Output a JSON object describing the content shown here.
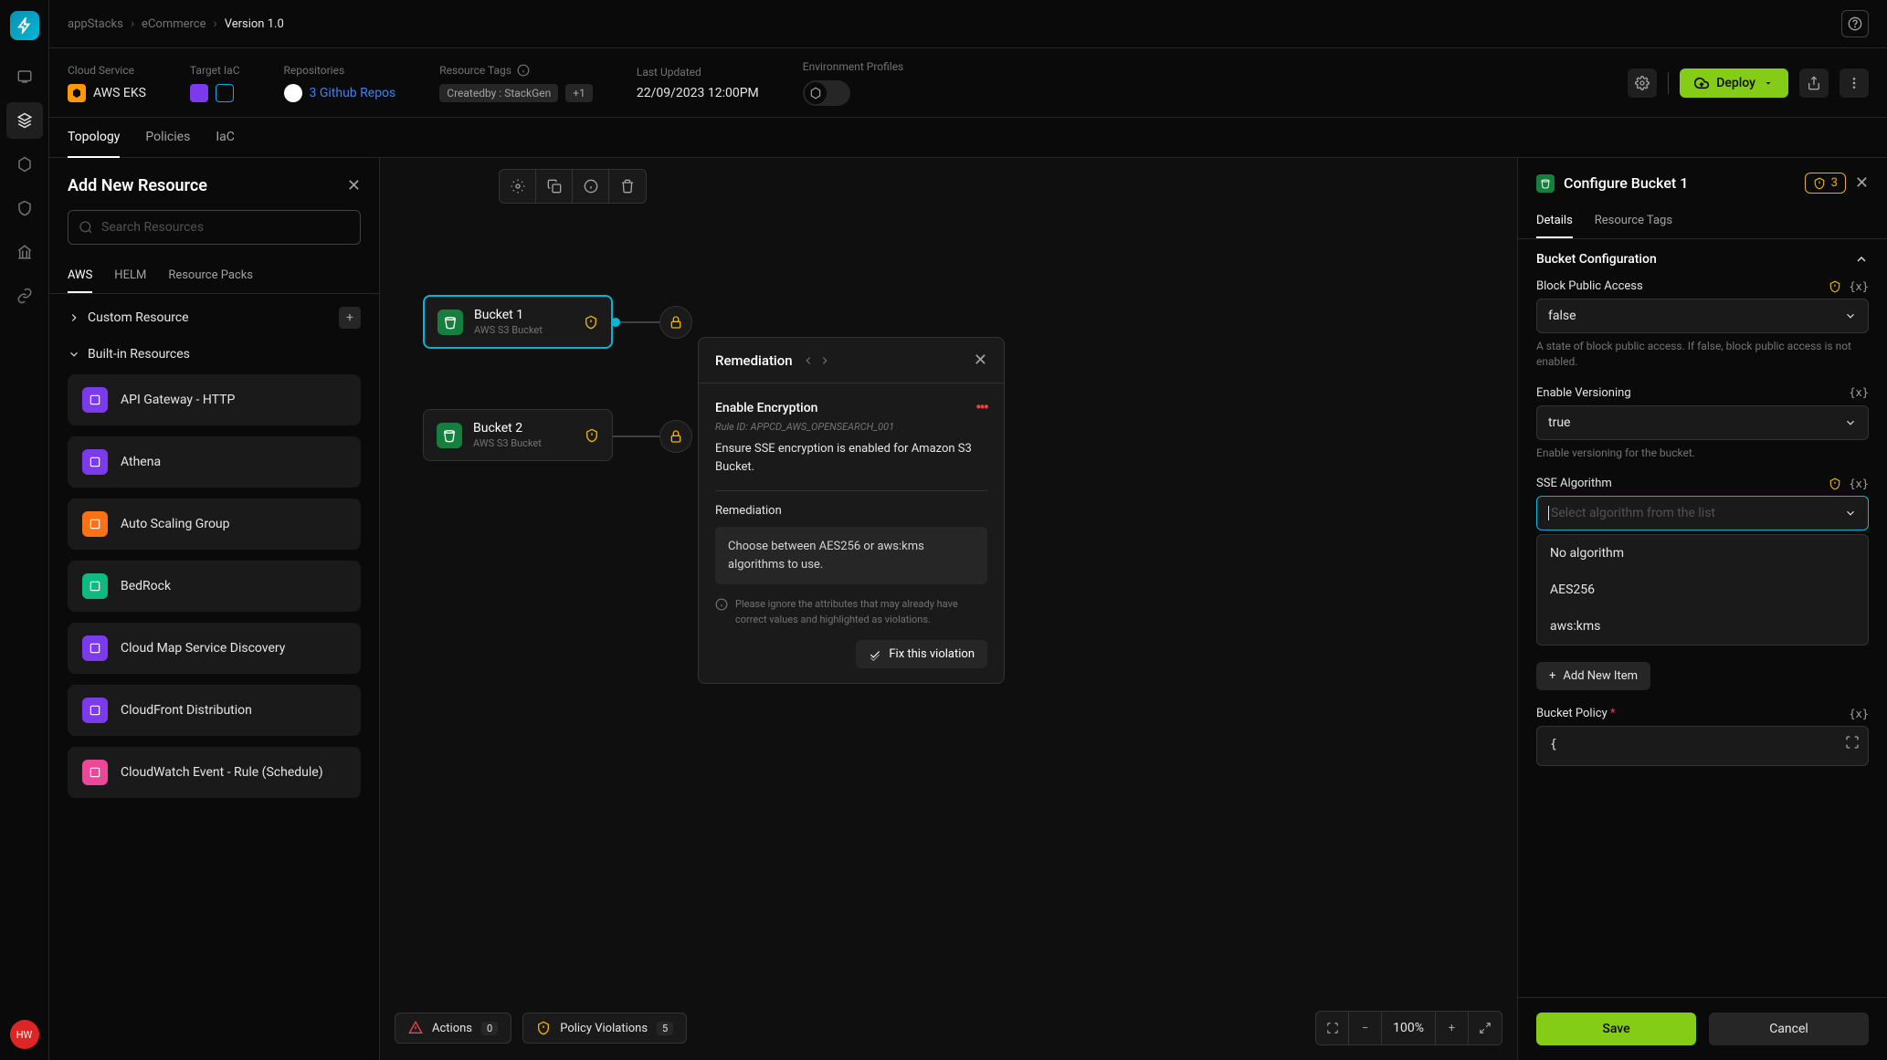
{
  "breadcrumbs": [
    "appStacks",
    "eCommerce",
    "Version 1.0"
  ],
  "meta": {
    "cloud_service": {
      "label": "Cloud Service",
      "value": "AWS EKS"
    },
    "target_iac": {
      "label": "Target IaC"
    },
    "repositories": {
      "label": "Repositories",
      "value": "3 Github Repos"
    },
    "resource_tags": {
      "label": "Resource Tags",
      "chip": "Createdby : StackGen",
      "more": "+1"
    },
    "last_updated": {
      "label": "Last Updated",
      "value": "22/09/2023 12:00PM"
    },
    "env_profiles": {
      "label": "Environment Profiles"
    }
  },
  "deploy_label": "Deploy",
  "main_tabs": [
    "Topology",
    "Policies",
    "IaC"
  ],
  "left_panel": {
    "title": "Add New Resource",
    "search_placeholder": "Search Resources",
    "sub_tabs": [
      "AWS",
      "HELM",
      "Resource Packs"
    ],
    "custom_resource": "Custom Resource",
    "builtin_header": "Built-in Resources",
    "resources": [
      {
        "name": "API Gateway - HTTP",
        "color": "#7c3aed"
      },
      {
        "name": "Athena",
        "color": "#7c3aed"
      },
      {
        "name": "Auto Scaling Group",
        "color": "#f97316"
      },
      {
        "name": "BedRock",
        "color": "#10b981"
      },
      {
        "name": "Cloud Map Service Discovery",
        "color": "#7c3aed"
      },
      {
        "name": "CloudFront Distribution",
        "color": "#7c3aed"
      },
      {
        "name": "CloudWatch Event - Rule (Schedule)",
        "color": "#ec4899"
      }
    ]
  },
  "canvas": {
    "nodes": [
      {
        "title": "Bucket 1",
        "subtitle": "AWS S3 Bucket"
      },
      {
        "title": "Bucket 2",
        "subtitle": "AWS S3 Bucket"
      }
    ],
    "popup": {
      "title": "Remediation",
      "section_title": "Enable Encryption",
      "rule_id": "Rule ID: APPCD_AWS_OPENSEARCH_001",
      "description": "Ensure SSE encryption is enabled for Amazon S3 Bucket.",
      "sub_head": "Remediation",
      "code_text": "Choose between AES256 or aws:kms algorithms to use.",
      "note": "Please ignore the attributes that may already have correct values and highlighted as violations.",
      "fix_label": "Fix this violation"
    },
    "actions": {
      "label": "Actions",
      "count": "0"
    },
    "violations": {
      "label": "Policy Violations",
      "count": "5"
    },
    "zoom": "100%"
  },
  "right_panel": {
    "title": "Configure Bucket 1",
    "badge_count": "3",
    "tabs": [
      "Details",
      "Resource Tags"
    ],
    "section": "Bucket Configuration",
    "fields": {
      "block_public": {
        "label": "Block Public Access",
        "value": "false",
        "help": "A state of block public access. If false, block public access is not enabled."
      },
      "versioning": {
        "label": "Enable Versioning",
        "value": "true",
        "help": "Enable versioning for the bucket."
      },
      "sse": {
        "label": "SSE Algorithm",
        "placeholder": "Select algorithm from the list",
        "options": [
          "No algorithm",
          "AES256",
          "aws:kms"
        ]
      },
      "policy": {
        "label": "Bucket Policy",
        "value": "{"
      }
    },
    "add_item": "Add New Item",
    "save": "Save",
    "cancel": "Cancel"
  },
  "rail_avatar": "HW"
}
